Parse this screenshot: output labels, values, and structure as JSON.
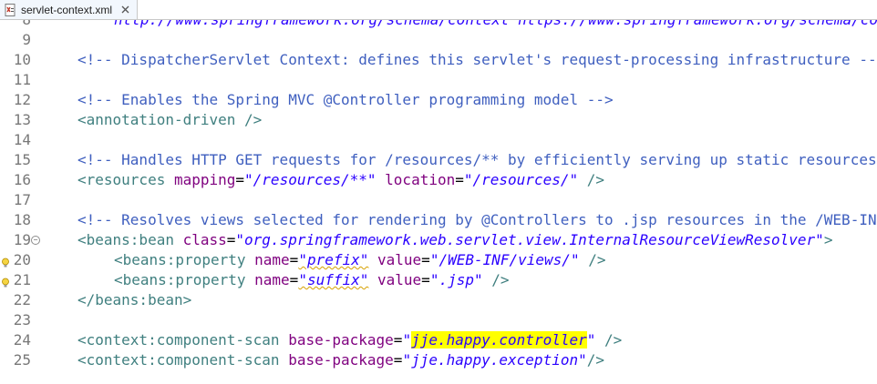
{
  "tab": {
    "title": "servlet-context.xml",
    "icon": "xml-file-icon",
    "close_icon": "close-icon"
  },
  "lines": [
    {
      "n": "8",
      "url": "http://www.springframework.org/schema/context https://www.springframework.org/schema/context/spring-context.xsd"
    },
    {
      "n": "9"
    },
    {
      "n": "10",
      "comment": "<!-- DispatcherServlet Context: defines this servlet's request-processing infrastructure -->"
    },
    {
      "n": "11"
    },
    {
      "n": "12",
      "comment": "<!-- Enables the Spring MVC @Controller programming model -->"
    },
    {
      "n": "13",
      "open": "<annotation-driven />"
    },
    {
      "n": "14"
    },
    {
      "n": "15",
      "comment": "<!-- Handles HTTP GET requests for /resources/** by efficiently serving up static resources in the ${webappRoot}/resources directory -->"
    },
    {
      "n": "16",
      "tag": "<resources",
      "a1": " mapping",
      "eq1": "=",
      "v1": "\"/resources/**\"",
      "a2": " location",
      "eq2": "=",
      "v2": "\"/resources/\"",
      "end": " />"
    },
    {
      "n": "17"
    },
    {
      "n": "18",
      "comment": "<!-- Resolves views selected for rendering by @Controllers to .jsp resources in the /WEB-INF/views directory -->"
    },
    {
      "n": "19",
      "tag": "<beans:bean",
      "a1": " class",
      "eq1": "=",
      "v1": "\"org.springframework.web.servlet.view.InternalResourceViewResolver\"",
      "end": ">"
    },
    {
      "n": "20",
      "tag": "<beans:property",
      "a1": " name",
      "eq1": "=",
      "v1": "\"prefix\"",
      "a2": " value",
      "eq2": "=",
      "v2": "\"/WEB-INF/views/\"",
      "end": " />"
    },
    {
      "n": "21",
      "tag": "<beans:property",
      "a1": " name",
      "eq1": "=",
      "v1": "\"suffix\"",
      "a2": " value",
      "eq2": "=",
      "v2": "\".jsp\"",
      "end": " />"
    },
    {
      "n": "22",
      "close": "</beans:bean>"
    },
    {
      "n": "23"
    },
    {
      "n": "24",
      "tag": "<context:component-scan",
      "a1": " base-package",
      "eq1": "=",
      "q": "\"",
      "v1": "jje.happy.controller",
      "q2": "\"",
      "end": " />"
    },
    {
      "n": "25",
      "tag": "<context:component-scan",
      "a1": " base-package",
      "eq1": "=",
      "v1": "\"jje.happy.exception\"",
      "end": "/>"
    }
  ],
  "colors": {
    "comment": "#3f5fbf",
    "tag": "#3f7f7f",
    "attr": "#7f007f",
    "value": "#2a00ff",
    "highlight": "#ffff00"
  },
  "markers": {
    "fold_19": "collapse-icon",
    "warn_20": "warning-bulb-icon",
    "warn_21": "warning-bulb-icon"
  }
}
